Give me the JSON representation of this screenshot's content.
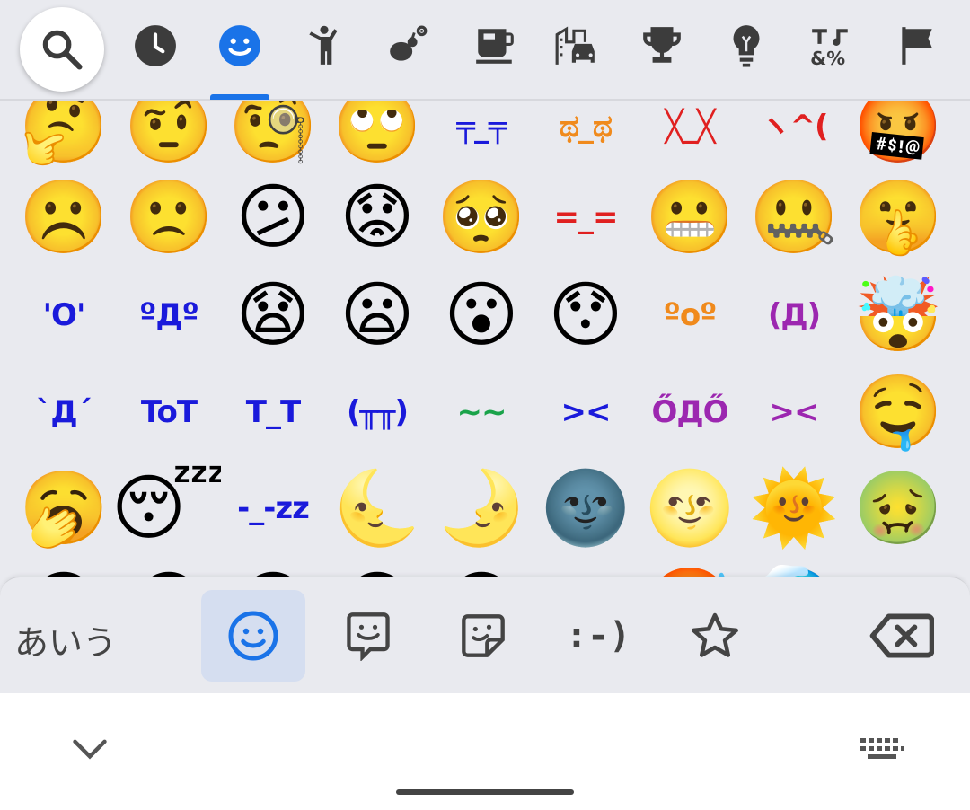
{
  "categories": [
    {
      "id": "search",
      "icon": "search-icon"
    },
    {
      "id": "recent",
      "icon": "clock-icon"
    },
    {
      "id": "smileys",
      "icon": "smiley-icon",
      "selected": true
    },
    {
      "id": "people",
      "icon": "person-icon"
    },
    {
      "id": "animals",
      "icon": "bug-flower-icon"
    },
    {
      "id": "food",
      "icon": "coffee-icon"
    },
    {
      "id": "travel",
      "icon": "city-car-icon"
    },
    {
      "id": "activities",
      "icon": "trophy-icon"
    },
    {
      "id": "objects",
      "icon": "lightbulb-icon"
    },
    {
      "id": "symbols",
      "icon": "symbols-icon"
    },
    {
      "id": "flags",
      "icon": "flag-icon"
    }
  ],
  "grid": {
    "rows": [
      [
        "🤔",
        "🤨",
        "🧐",
        "🙄",
        "╤_╤",
        "ಥ_ಥ",
        "╳_╳",
        "ヽ^(",
        "🤬"
      ],
      [
        "☹️",
        "🙁",
        "😕",
        "😟",
        "🥺",
        "=_=",
        "😬",
        "🤐",
        "🤫"
      ],
      [
        "'O'",
        "ºДº",
        "😧",
        "😦",
        "😮",
        "😯",
        "ºoº",
        "(Д)",
        "🤯"
      ],
      [
        "`Д´",
        "ToT",
        "T_T",
        "(╥╥)",
        "~~",
        "><",
        "ŐДŐ",
        "><",
        "🤤"
      ],
      [
        "🥱",
        "😴",
        "-_-zz",
        "🌜",
        "🌛",
        "🌚",
        "🌝",
        "🌞",
        "🤢"
      ],
      [
        "😄",
        "😀",
        "😁",
        "😆",
        "😅",
        "",
        "🥵",
        "🥶",
        ""
      ]
    ],
    "kaomoji_colors": {
      "r0c4": "#1a1adb",
      "r0c5": "#f08a1c",
      "r0c6": "#e02020",
      "r0c7": "#e02020",
      "r1c5": "#e02020",
      "r2c0": "#1a1adb",
      "r2c1": "#1a1adb",
      "r2c6": "#f08a1c",
      "r2c7": "#9c27b0",
      "r3c0": "#1a1adb",
      "r3c1": "#1a1adb",
      "r3c2": "#1a1adb",
      "r3c3": "#1a1adb",
      "r3c4": "#1aa34a",
      "r3c5": "#1a1adb",
      "r3c6": "#9c27b0",
      "r3c7": "#9c27b0",
      "r4c2": "#1a1adb"
    }
  },
  "bottom_bar": {
    "kana_label": "あいう",
    "tabs": [
      {
        "id": "emoji",
        "icon": "smiley-icon",
        "active": true
      },
      {
        "id": "emoticon-face",
        "icon": "face-bubble-icon"
      },
      {
        "id": "sticker",
        "icon": "sticker-icon"
      },
      {
        "id": "kaomoji",
        "text": ":-)"
      },
      {
        "id": "favorites",
        "icon": "star-icon"
      }
    ],
    "delete_icon": "backspace-icon"
  },
  "nav": {
    "collapse_icon": "chevron-down-icon",
    "keyboard_icon": "keyboard-icon"
  },
  "colors": {
    "accent": "#1a73e8",
    "icon_gray": "#3c3c3c",
    "background": "#e9eaef"
  }
}
